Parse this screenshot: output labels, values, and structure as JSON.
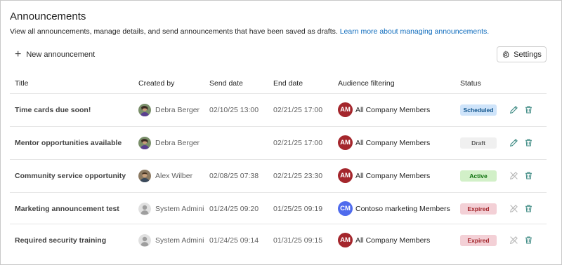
{
  "page": {
    "title": "Announcements",
    "description": "View all announcements, manage details, and send announcements that have been saved as drafts. ",
    "learn_more": "Learn more about managing announcements.",
    "new_announcement": "New announcement",
    "settings": "Settings"
  },
  "columns": {
    "title": "Title",
    "created_by": "Created by",
    "send_date": "Send date",
    "end_date": "End date",
    "audience": "Audience filtering",
    "status": "Status"
  },
  "rows": [
    {
      "title": "Time cards due soon!",
      "created_by": "Debra Berger",
      "avatar": "photo-debra",
      "send_date": "02/10/25 13:00",
      "end_date": "02/21/25 17:00",
      "aud_initials": "AM",
      "aud_color": "#a4262c",
      "audience": "All Company Members",
      "status": "Scheduled",
      "status_bg": "#cfe4fa",
      "status_fg": "#0f548c",
      "edit_icon": "pencil-icon"
    },
    {
      "title": "Mentor opportunities available",
      "created_by": "Debra Berger",
      "avatar": "photo-debra",
      "send_date": "",
      "end_date": "02/21/25 17:00",
      "aud_initials": "AM",
      "aud_color": "#a4262c",
      "audience": "All Company Members",
      "status": "Draft",
      "status_bg": "#f0f0f0",
      "status_fg": "#616161",
      "edit_icon": "pencil-icon"
    },
    {
      "title": "Community service opportunity",
      "created_by": "Alex Wilber",
      "avatar": "photo-alex",
      "send_date": "02/08/25 07:38",
      "end_date": "02/21/25 23:30",
      "aud_initials": "AM",
      "aud_color": "#a4262c",
      "audience": "All Company Members",
      "status": "Active",
      "status_bg": "#d2f0c8",
      "status_fg": "#0e700e",
      "edit_icon": "pencil-off-icon"
    },
    {
      "title": "Marketing announcement test",
      "created_by": "System Administr",
      "avatar": "person-placeholder",
      "send_date": "01/24/25 09:20",
      "end_date": "01/25/25 09:19",
      "aud_initials": "CM",
      "aud_color": "#4f6bed",
      "audience": "Contoso marketing Members",
      "status": "Expired",
      "status_bg": "#f3d0d6",
      "status_fg": "#a4262c",
      "edit_icon": "pencil-off-icon"
    },
    {
      "title": "Required security training",
      "created_by": "System Administr",
      "avatar": "person-placeholder",
      "send_date": "01/24/25 09:14",
      "end_date": "01/31/25 09:15",
      "aud_initials": "AM",
      "aud_color": "#a4262c",
      "audience": "All Company Members",
      "status": "Expired",
      "status_bg": "#f3d0d6",
      "status_fg": "#a4262c",
      "edit_icon": "pencil-off-icon"
    }
  ]
}
